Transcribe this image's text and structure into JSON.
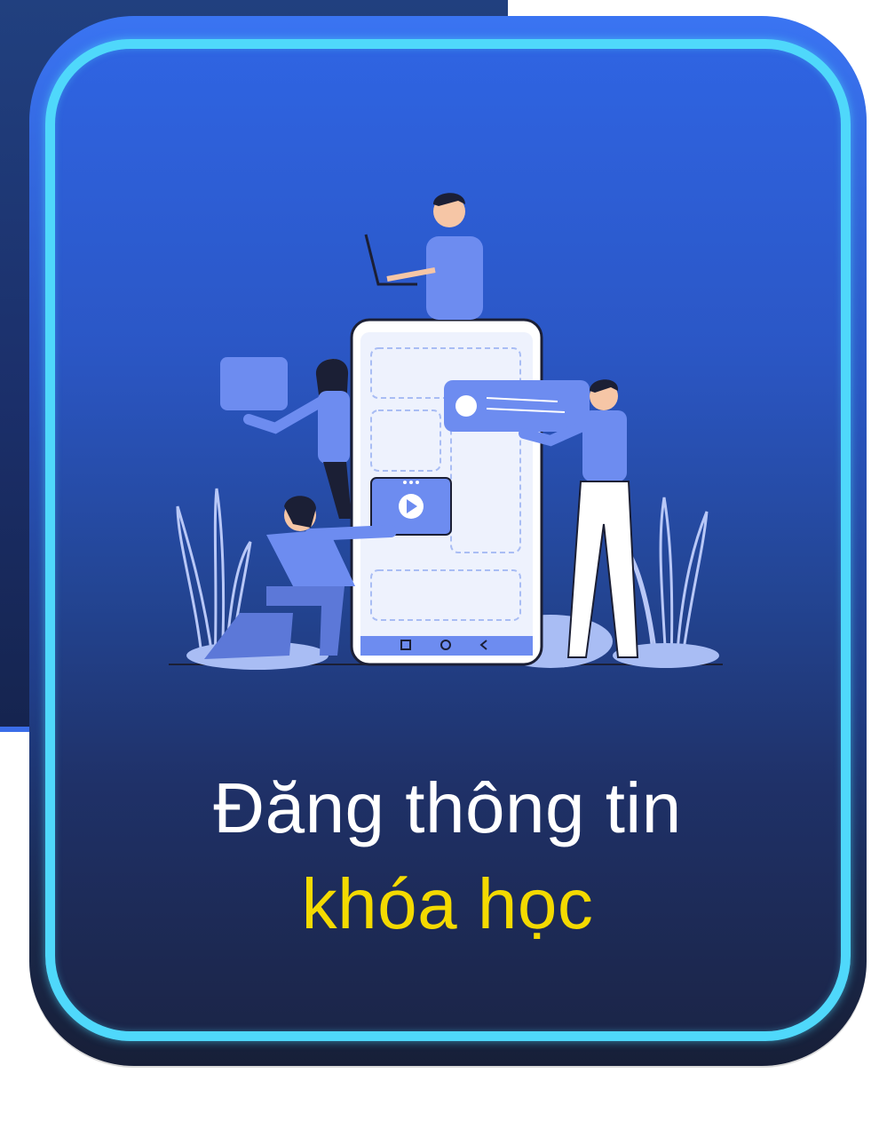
{
  "title": {
    "line1": "Đăng thông tin",
    "line2": "khóa học"
  },
  "colors": {
    "accent_cyan": "#4fd8fb",
    "card_top": "#3a74f2",
    "card_bottom": "#171f38",
    "highlight_yellow": "#f4da00",
    "figure_blue": "#6d8cf0"
  },
  "illustration": {
    "icon": "team-building-mobile-app-illustration"
  }
}
